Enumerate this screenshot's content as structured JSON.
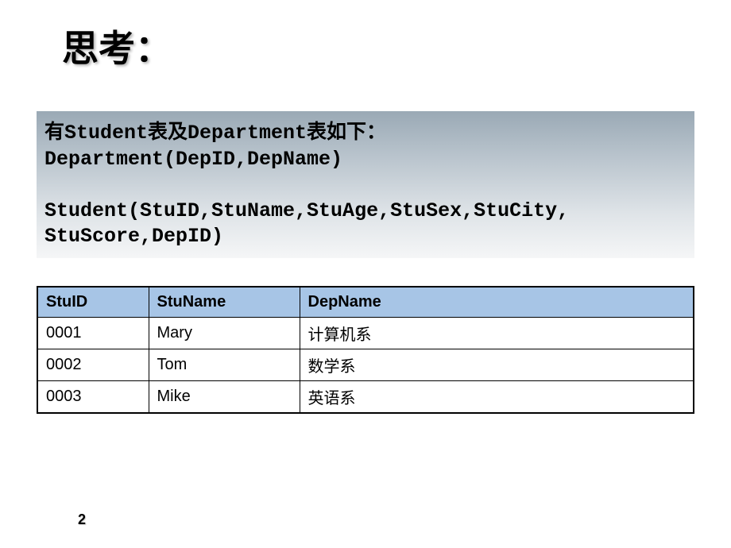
{
  "title": "思考：",
  "description": {
    "line1": "有Student表及Department表如下：",
    "line2": "Department(DepID,DepName)",
    "line3": "",
    "line4": "Student(StuID,StuName,StuAge,StuSex,StuCity,",
    "line5": "StuScore,DepID)"
  },
  "table": {
    "headers": [
      "StuID",
      "StuName",
      "DepName"
    ],
    "rows": [
      [
        "0001",
        "Mary",
        "计算机系"
      ],
      [
        "0002",
        "Tom",
        "数学系"
      ],
      [
        "0003",
        "Mike",
        "英语系"
      ]
    ]
  },
  "pageNumber": "2"
}
